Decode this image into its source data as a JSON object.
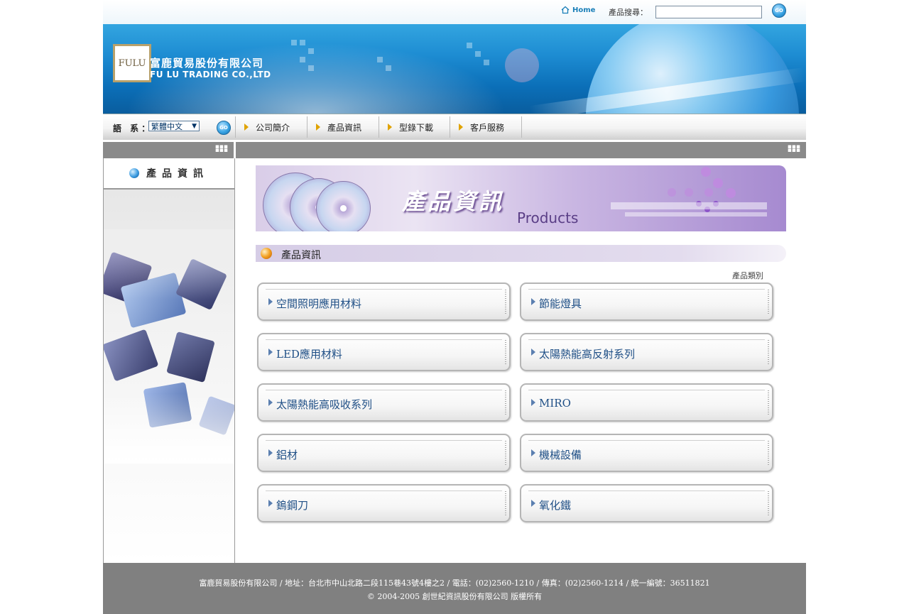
{
  "header": {
    "home_label": "Home",
    "search_label": "產品搜尋：",
    "search_value": "",
    "go_label": "GO"
  },
  "logo": {
    "mark": "FULU",
    "company_cn": "富鹿貿易股份有限公司",
    "company_en": "FU LU TRADING CO.,LTD"
  },
  "nav": {
    "lang_label": "語 系：",
    "lang_selected": "繁體中文",
    "items": [
      {
        "label": "公司簡介"
      },
      {
        "label": "產品資訊"
      },
      {
        "label": "型錄下載"
      },
      {
        "label": "客戶服務"
      }
    ]
  },
  "sidebar": {
    "title": "產品資訊"
  },
  "main": {
    "banner_cn": "產品資訊",
    "banner_en": "Products",
    "section_title": "產品資訊",
    "category_link": "產品類別",
    "categories": [
      {
        "label": "空間照明應用材料"
      },
      {
        "label": "節能燈具"
      },
      {
        "label": "LED應用材料"
      },
      {
        "label": "太陽熱能高反射系列"
      },
      {
        "label": "太陽熱能高吸收系列"
      },
      {
        "label": "MIRO"
      },
      {
        "label": "鋁材"
      },
      {
        "label": "機械設備"
      },
      {
        "label": "鎢鋼刀"
      },
      {
        "label": "氧化鐵"
      }
    ]
  },
  "footer": {
    "line1": "富鹿貿易股份有限公司 / 地址：台北市中山北路二段115巷43號4樓之2 / 電話：(02)2560-1210 / 傳真：(02)2560-1214 / 統一編號：36511821",
    "line2": "© 2004-2005 創世紀資訊股份有限公司 版權所有"
  },
  "colors": {
    "accent": "#1a7fb8",
    "footer_bg": "#808080",
    "card_text": "#1f4f86"
  }
}
